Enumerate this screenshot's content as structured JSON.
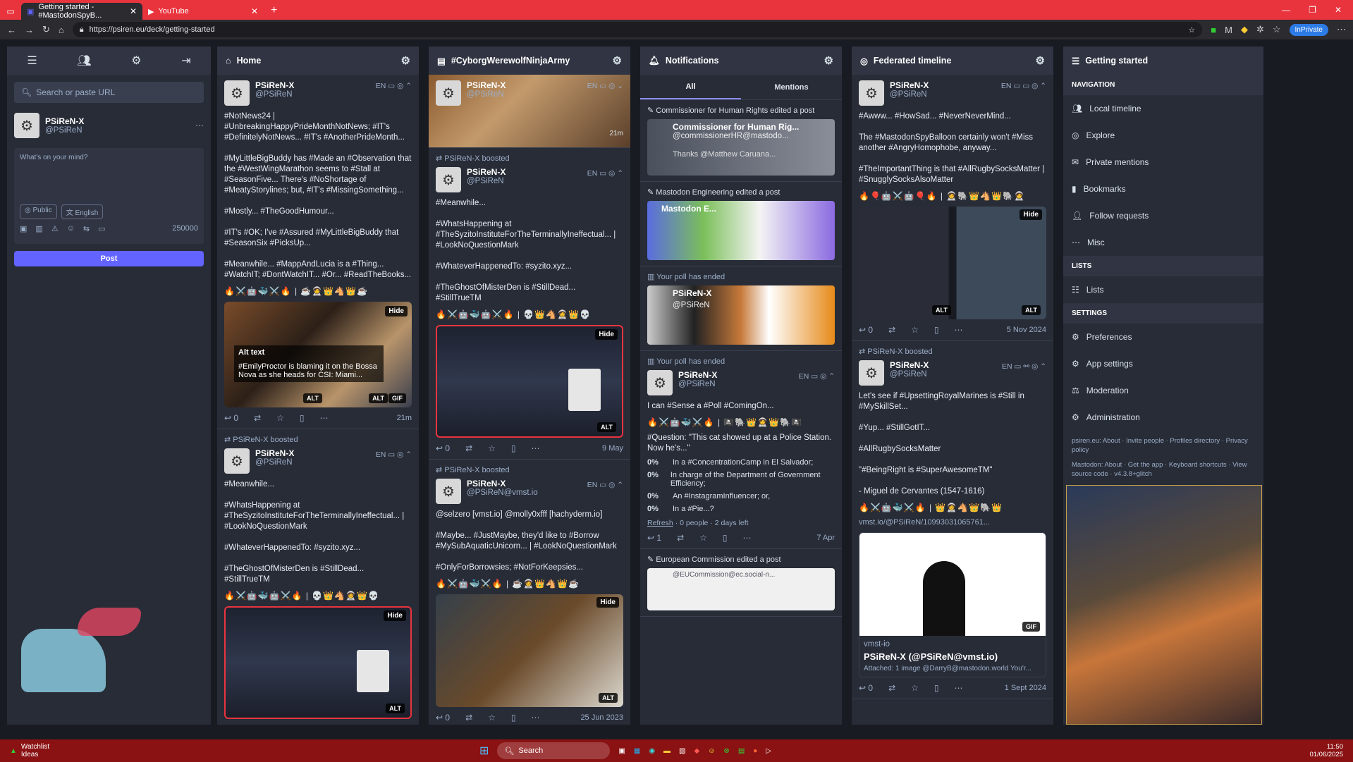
{
  "browser": {
    "tabs": [
      {
        "title": "Getting started - #MastodonSpyB..."
      },
      {
        "title": "YouTube"
      }
    ],
    "url": "https://psiren.eu/deck/getting-started",
    "inprivate": "InPrivate"
  },
  "sidebar": {
    "search_placeholder": "Search or paste URL",
    "user_name": "PSiReN-X",
    "user_handle": "@PSiReN",
    "compose_placeholder": "What's on your mind?",
    "visibility": "Public",
    "language": "English",
    "char_count": "250000",
    "post_label": "Post"
  },
  "columns": {
    "home": {
      "title": "Home",
      "posts": [
        {
          "name": "PSiReN-X",
          "handle": "@PSiReN",
          "lang": "EN",
          "text": "#NotNews24 | #UnbreakingHappyPrideMonthNotNews; #IT's #DefinitelyNotNews... #IT's #AnotherPrideMonth...\n\n#MyLittleBigBuddy has #Made an #Observation that the #WestWingMarathon seems to #Stall at #SeasonFive... There's #NoShortage of #MeatyStorylines; but, #IT's #MissingSomething...\n\n#Mostly... #TheGoodHumour...\n\n#IT's #OK; I've #Assured #MyLittleBigBuddy that #SeasonSix #PicksUp...\n\n#Meanwhile... #MappAndLucia is a #Thing... #WatchIT; #DontWatchIT... #Or... #ReadTheBooks...",
          "emoji": "🔥⚔️🤖🐳⚔️🔥 | ☕🧑‍🚀👑🐴👑☕",
          "alt_title": "Alt text",
          "alt_text": "#EmilyProctor is blaming it on the Bossa Nova as she heads for CSI: Miami...",
          "hide": "Hide",
          "alt": "ALT",
          "gif": "GIF",
          "replies": "0",
          "time": "21m"
        },
        {
          "booster": "PSiReN-X",
          "boosted": "boosted",
          "name": "PSiReN-X",
          "handle": "@PSiReN",
          "lang": "EN",
          "text": "#Meanwhile...\n\n#WhatsHappening at #TheSyzitoInstituteForTheTerminallyIneffectual... | #LookNoQuestionMark\n\n#WhateverHappenedTo: #syzito.xyz...\n\n#TheGhostOfMisterDen is #StillDead... #StillTrueTM",
          "emoji": "🔥⚔️🤖🐳🤖⚔️🔥 | 💀👑🐴🧑‍🚀👑💀",
          "hide": "Hide",
          "alt": "ALT"
        }
      ]
    },
    "cyborg": {
      "title": "#CyborgWerewolfNinjaArmy",
      "posts": [
        {
          "name": "PSiReN-X",
          "handle": "@PSiReN",
          "lang": "EN",
          "time": "21m"
        },
        {
          "booster": "PSiReN-X",
          "boosted": "boosted",
          "name": "PSiReN-X",
          "handle": "@PSiReN",
          "lang": "EN",
          "text": "#Meanwhile...\n\n#WhatsHappening at #TheSyzitoInstituteForTheTerminallyIneffectual... | #LookNoQuestionMark\n\n#WhateverHappenedTo: #syzito.xyz...\n\n#TheGhostOfMisterDen is #StillDead... #StillTrueTM",
          "emoji": "🔥⚔️🤖🐳🤖⚔️🔥 | 💀👑🐴🧑‍🚀👑💀",
          "hide": "Hide",
          "alt": "ALT",
          "replies": "0",
          "time": "9 May"
        },
        {
          "booster": "PSiReN-X",
          "boosted": "boosted",
          "name": "PSiReN-X",
          "handle": "@PSiReN@vmst.io",
          "lang": "EN",
          "text": "@selzero [vmst.io] @molly0xfff [hachyderm.io]\n\n#Maybe... #JustMaybe, they'd like to #Borrow #MySubAquaticUnicorn... | #LookNoQuestionMark\n\n#OnlyForBorrowsies; #NotForKeepsies...",
          "emoji": "🔥⚔️🤖🐳⚔️🔥 | ☕🧑‍🚀👑🐴👑☕",
          "hide": "Hide",
          "alt": "ALT",
          "replies": "0",
          "time": "25 Jun 2023"
        }
      ]
    },
    "notifications": {
      "title": "Notifications",
      "tab_all": "All",
      "tab_mentions": "Mentions",
      "items": [
        {
          "label": "Commissioner for Human Rights edited a post",
          "card_name": "Commissioner for Human Rig...",
          "card_handle": "@commissionerHR@mastodo...",
          "card_text": "Thanks @Matthew Caruana..."
        },
        {
          "label": "Mastodon Engineering edited a post",
          "card_name": "Mastodon E..."
        },
        {
          "label": "Your poll has ended",
          "card_name": "PSiReN-X",
          "card_handle": "@PSiReN"
        },
        {
          "label": "Your poll has ended"
        }
      ],
      "poll_post": {
        "name": "PSiReN-X",
        "handle": "@PSiReN",
        "lang": "EN",
        "text": "I can #Sense a #Poll #ComingOn...",
        "emoji": "🔥⚔️🤖🐳⚔️🔥 | 🏴‍☠️🐘👑🧑‍🚀👑🐘🏴‍☠️",
        "question": "#Question: \"This cat showed up at a Police Station. Now he's...\"",
        "options": [
          {
            "pct": "0%",
            "text": "In a #ConcentrationCamp in El Salvador;"
          },
          {
            "pct": "0%",
            "text": "In charge of the Department of Government Efficiency;"
          },
          {
            "pct": "0%",
            "text": "An #InstagramInfluencer; or,"
          },
          {
            "pct": "0%",
            "text": "In a #Pie...?"
          }
        ],
        "refresh": "Refresh",
        "footer": "· 0 people · 2 days left",
        "replies": "1",
        "time": "7 Apr"
      },
      "last": {
        "label": "European Commission edited a post",
        "card_handle": "@EUCommission@ec.social-n..."
      }
    },
    "federated": {
      "title": "Federated timeline",
      "posts": [
        {
          "name": "PSiReN-X",
          "handle": "@PSiReN",
          "lang": "EN",
          "text": "#Awww... #HowSad... #NeverNeverMind...\n\nThe #MastodonSpyBalloon certainly won't #Miss another #AngryHomophobe, anyway...\n\n#TheImportantThing is that #AllRugbySocksMatter | #SnugglySocksAlsoMatter",
          "emoji": "🔥🎈🤖⚔️🤖🎈🔥 | 🧑‍🚀🐘👑🐴👑🐘🧑‍🚀",
          "hide": "Hide",
          "alt": "ALT",
          "replies": "0",
          "time": "5 Nov 2024"
        },
        {
          "booster": "PSiReN-X",
          "boosted": "boosted",
          "name": "PSiReN-X",
          "handle": "@PSiReN",
          "lang": "EN",
          "text": "Let's see if #UpsettingRoyalMarines is #Still in #MySkillSet...\n\n#Yup... #StillGotIT...\n\n#AllRugbySocksMatter\n\n\"#BeingRight is #SuperAwesomeTM\"\n\n- Miguel de Cervantes (1547-1616)",
          "emoji": "🔥⚔️🤖🐳⚔️🔥 | 👑🧑‍🚀🐴👑🐘👑",
          "link": "vmst.io/@PSiReN/10993031065761...",
          "card_site": "vmst-io",
          "card_title": "PSiReN-X (@PSiReN@vmst.io)",
          "card_desc": "Attached: 1 image @DarryB@mastodon.world You'r...",
          "gif": "GIF",
          "replies": "0",
          "time": "1 Sept 2024"
        }
      ]
    },
    "getting_started": {
      "title": "Getting started",
      "nav_head": "Navigation",
      "nav": [
        "Local timeline",
        "Explore",
        "Private mentions",
        "Bookmarks",
        "Follow requests",
        "Misc"
      ],
      "lists_head": "Lists",
      "lists": [
        "Lists"
      ],
      "settings_head": "Settings",
      "settings": [
        "Preferences",
        "App settings",
        "Moderation",
        "Administration"
      ],
      "footer1": "psiren.eu: About · Invite people · Profiles directory · Privacy policy",
      "footer2": "Mastodon: About · Get the app · Keyboard shortcuts · View source code · v4.3.8+glitch"
    }
  },
  "taskbar": {
    "widget_title": "Watchlist",
    "widget_sub": "Ideas",
    "search": "Search",
    "time": "11:50",
    "date": "01/06/2025"
  }
}
